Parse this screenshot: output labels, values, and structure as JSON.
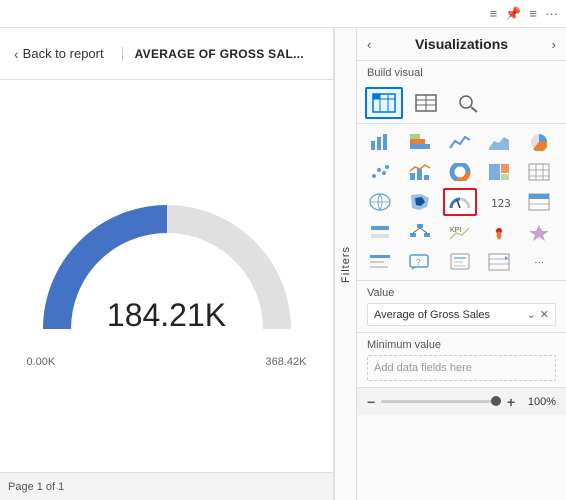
{
  "toolbar": {
    "icons": [
      "≡",
      "📌",
      "≡",
      "···"
    ]
  },
  "header": {
    "back_label": "Back to report",
    "report_title": "AVERAGE OF GROSS SAL..."
  },
  "chart": {
    "value": "184.21K",
    "min_label": "0.00K",
    "max_label": "368.42K"
  },
  "filters": {
    "label": "Filters"
  },
  "footer": {
    "page_label": "Page 1 of 1"
  },
  "viz_panel": {
    "title": "Visualizations",
    "build_visual": "Build visual",
    "sections": [
      {
        "name": "Value",
        "field": "Average of Gross Sales",
        "has_field": true
      },
      {
        "name": "Minimum value",
        "placeholder": "Add data fields here",
        "has_field": false
      }
    ],
    "zoom": {
      "pct": "100%",
      "minus": "−",
      "plus": "+"
    }
  }
}
